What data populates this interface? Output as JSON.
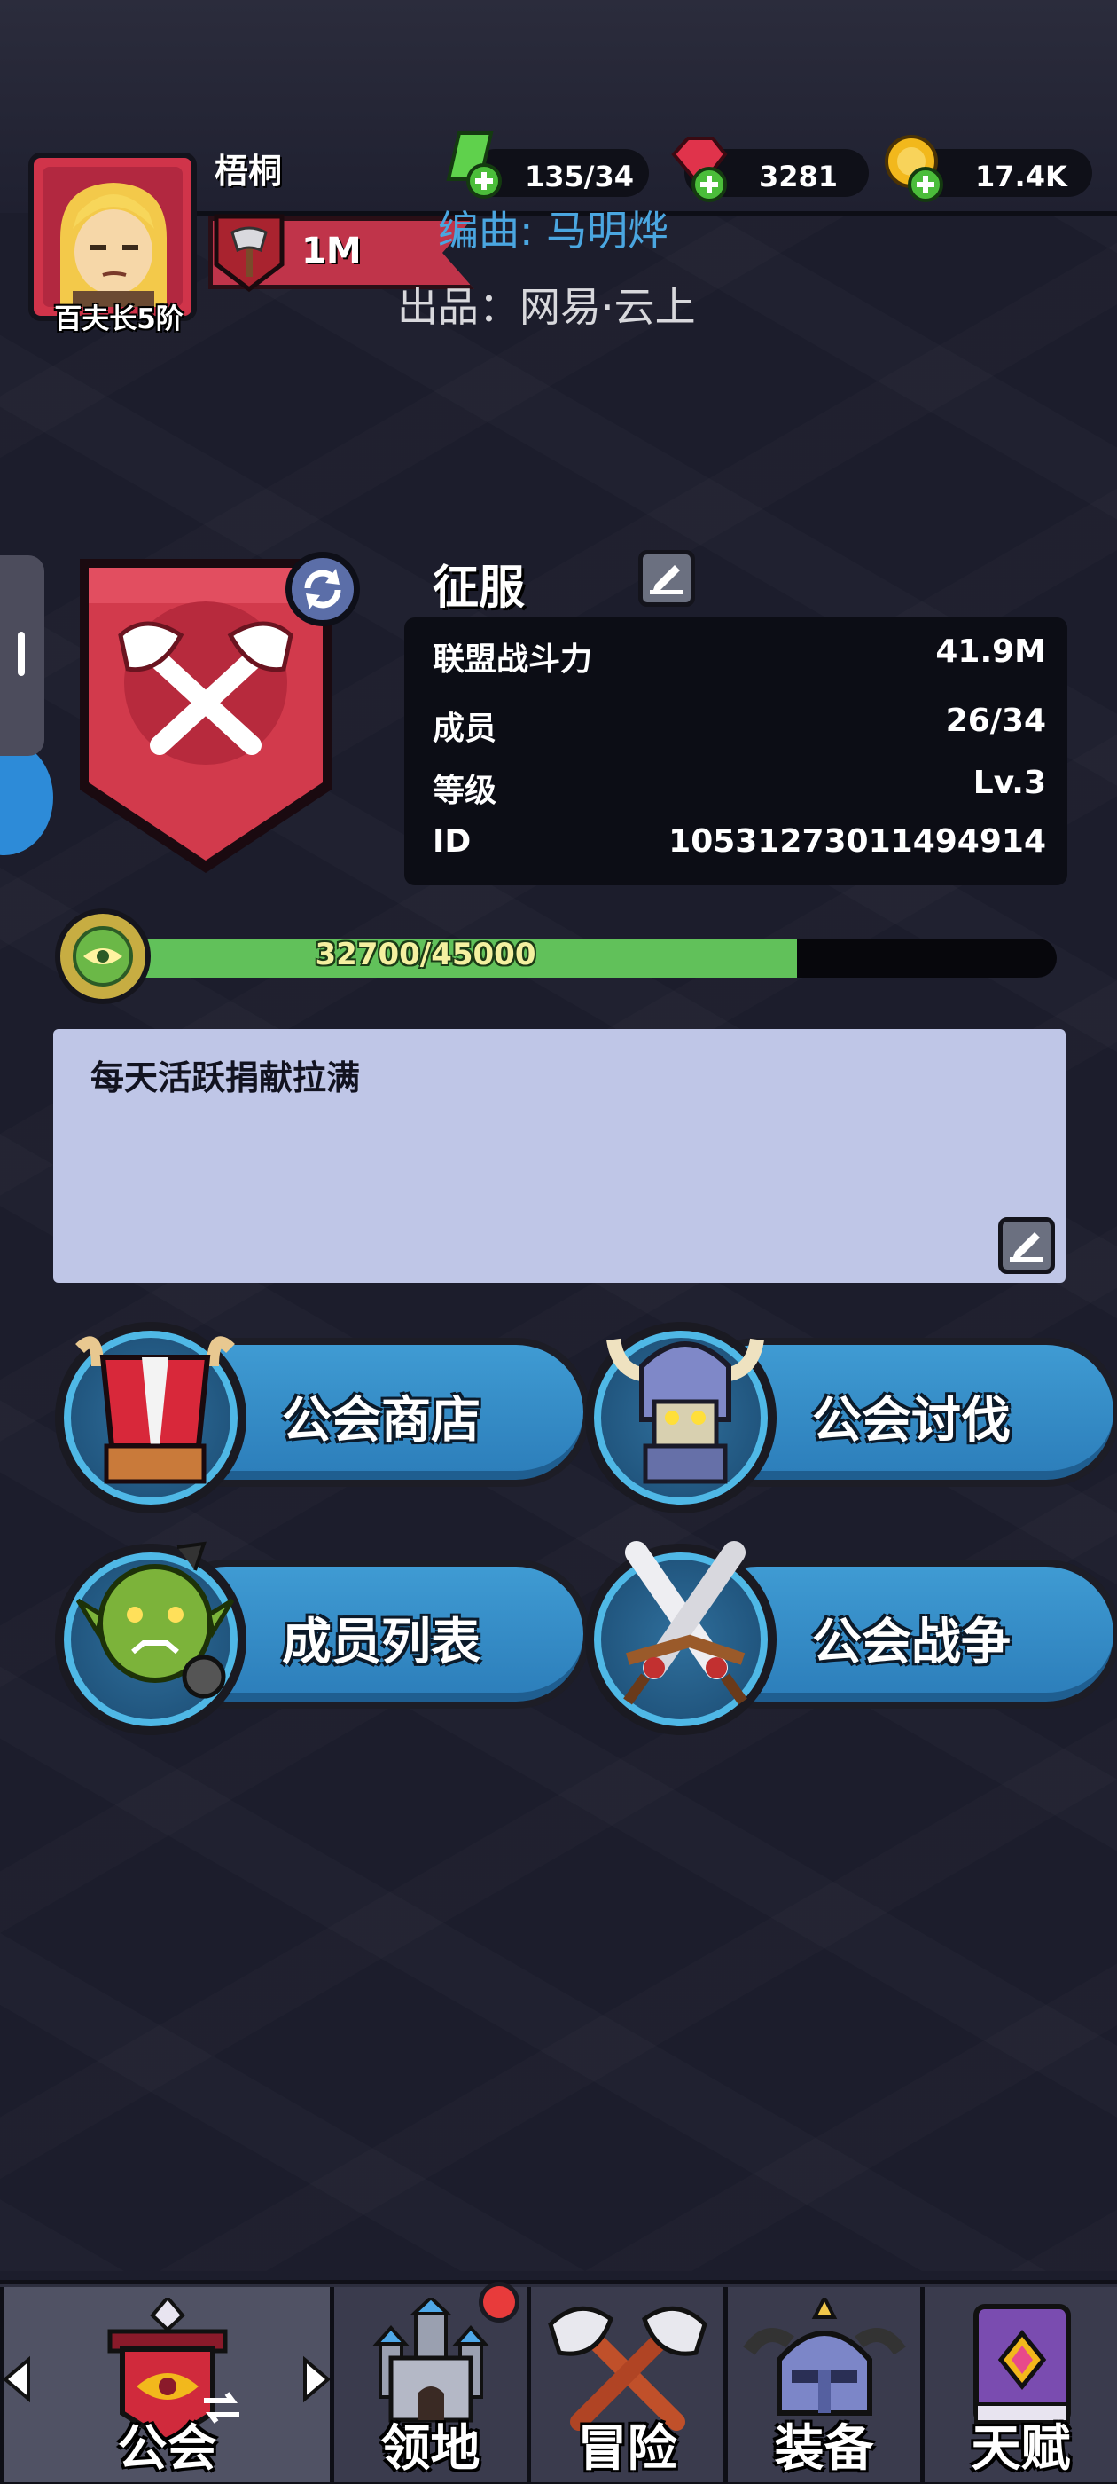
{
  "player": {
    "name": "梧桐",
    "rank": "百夫长5阶",
    "power": "1M"
  },
  "currencies": [
    {
      "icon": "green-gem-plus-icon",
      "value": "135/34",
      "color": "#5fd14c"
    },
    {
      "icon": "red-ruby-plus-icon",
      "value": "3281",
      "color": "#e0334b"
    },
    {
      "icon": "gold-coin-plus-icon",
      "value": "17.4K",
      "color": "#f2b81c"
    }
  ],
  "credits": {
    "composer": "编曲: 马明烨",
    "producer": "出品：网易·云上"
  },
  "guild": {
    "name": "征服",
    "stats": [
      {
        "label": "联盟战斗力",
        "value": "41.9M"
      },
      {
        "label": "成员",
        "value": "26/34"
      },
      {
        "label": "等级",
        "value": "Lv.3"
      },
      {
        "label": "ID",
        "value": "10531273011494914"
      }
    ],
    "exp": {
      "current": 32700,
      "max": 45000,
      "text": "32700/45000"
    },
    "notice": "每天活跃捐献拉满"
  },
  "menu": [
    {
      "label": "公会商店",
      "icon": "guild-shop-icon"
    },
    {
      "label": "公会讨伐",
      "icon": "guild-raid-icon"
    },
    {
      "label": "成员列表",
      "icon": "member-list-icon"
    },
    {
      "label": "公会战争",
      "icon": "guild-war-icon"
    }
  ],
  "nav": [
    {
      "label": "公会",
      "icon": "guild-banner-icon",
      "active": true
    },
    {
      "label": "领地",
      "icon": "castle-icon",
      "badge": true
    },
    {
      "label": "冒险",
      "icon": "crossed-axes-icon"
    },
    {
      "label": "装备",
      "icon": "helmet-icon"
    },
    {
      "label": "天赋",
      "icon": "talent-book-icon"
    }
  ],
  "colors": {
    "background": "#1c1d2c",
    "accent_blue": "#3f9bd3",
    "progress_green": "#61c15a",
    "banner_red": "#c0344a"
  }
}
